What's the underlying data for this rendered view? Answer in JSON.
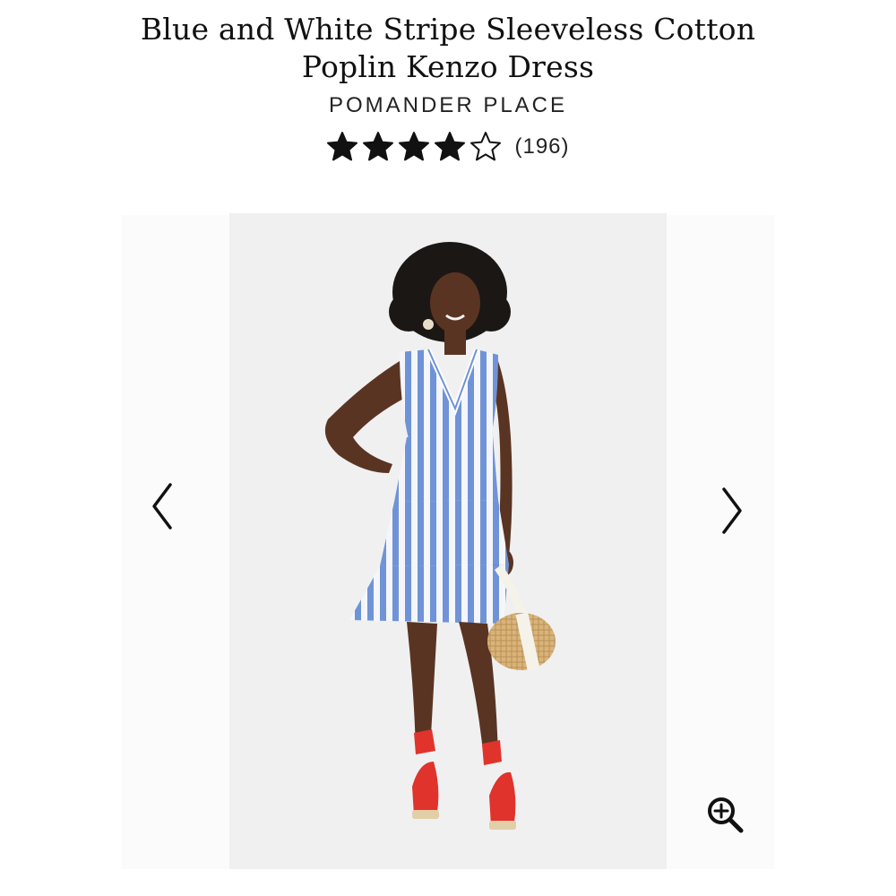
{
  "product": {
    "title": "Blue and White Stripe Sleeveless Cotton Poplin Kenzo Dress",
    "brand": "POMANDER PLACE",
    "rating": 4,
    "rating_max": 5,
    "review_count": "(196)"
  },
  "gallery": {
    "prev_icon": "chevron-left-icon",
    "next_icon": "chevron-right-icon",
    "zoom_icon": "zoom-in-icon",
    "image_subject": "model wearing dress"
  },
  "colors": {
    "text": "#111111",
    "image_bg": "#f0f0f1",
    "dress_blue": "#6f93d6",
    "shoe_red": "#e0332c"
  }
}
